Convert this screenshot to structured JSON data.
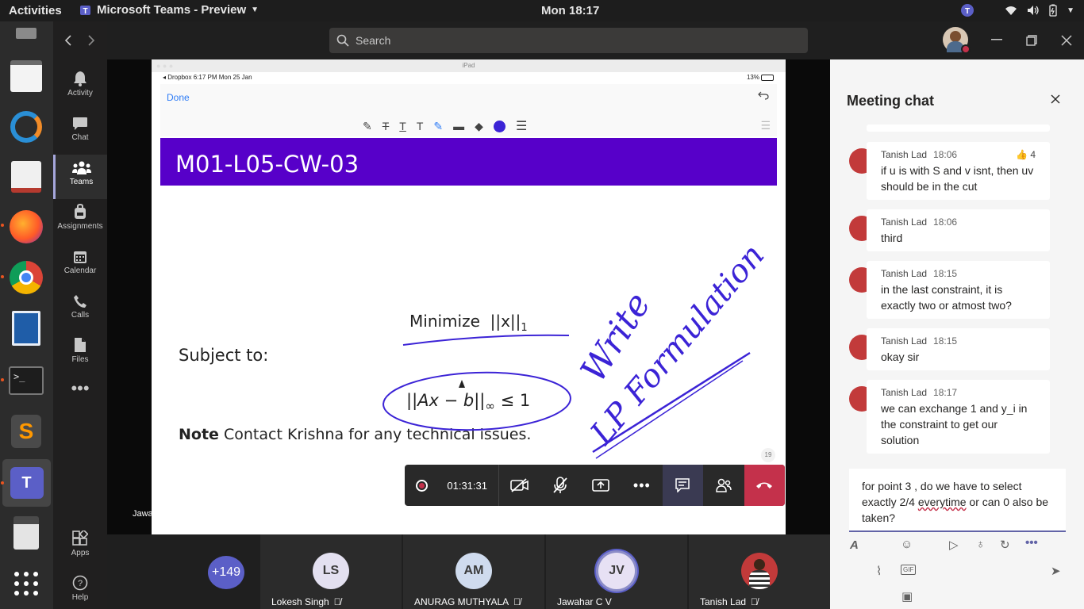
{
  "topbar": {
    "activities": "Activities",
    "app_name": "Microsoft Teams - Preview",
    "clock": "Mon 18:17"
  },
  "rail": [
    {
      "label": "Activity"
    },
    {
      "label": "Chat"
    },
    {
      "label": "Teams"
    },
    {
      "label": "Assignments"
    },
    {
      "label": "Calendar"
    },
    {
      "label": "Calls"
    },
    {
      "label": "Files"
    },
    {
      "label": "Apps"
    },
    {
      "label": "Help"
    }
  ],
  "header": {
    "search_placeholder": "Search"
  },
  "share": {
    "device": "iPad",
    "status_left": "◂ Dropbox  6:17 PM  Mon 25 Jan",
    "battery": "13%",
    "done": "Done",
    "slide_title": "M01-L05-CW-03",
    "minimize": "Minimize",
    "norm_x": "||x||",
    "norm_sub": "1",
    "subject_to": "Subject to:",
    "constraint": "||Ax − b||",
    "constraint_sub": "∞",
    "constraint_rhs": "≤ 1",
    "note_bold": "Note",
    "note_text": "Contact Krishna for any technical issues.",
    "page_no": "19",
    "presenter": "Jawahar C V",
    "handwriting_1": "Write",
    "handwriting_2": "LP Formulation"
  },
  "controls": {
    "timer": "01:31:31"
  },
  "participants": {
    "overflow": "+149",
    "tiles": [
      {
        "initials": "LS",
        "name": "Lokesh Singh",
        "color": "#e3e0f0"
      },
      {
        "initials": "AM",
        "name": "ANURAG MUTHYALA",
        "color": "#cfdbee"
      },
      {
        "initials": "JV",
        "name": "Jawahar C V",
        "color": "#e7e1f4"
      },
      {
        "initials": "",
        "name": "Tanish Lad",
        "color": "#c23a3a"
      }
    ]
  },
  "chat": {
    "title": "Meeting chat",
    "messages": [
      {
        "author": "Tanish Lad",
        "time": "18:06",
        "reaction": "👍 4",
        "text": "if u is with S and v isnt, then uv should be in the cut"
      },
      {
        "author": "Tanish Lad",
        "time": "18:06",
        "text": "third"
      },
      {
        "author": "Tanish Lad",
        "time": "18:15",
        "text": "in the last constraint, it is exactly two or atmost two?"
      },
      {
        "author": "Tanish Lad",
        "time": "18:15",
        "text": "okay sir"
      },
      {
        "author": "Tanish Lad",
        "time": "18:17",
        "text": "we can exchange 1 and y_i in the constraint to get our solution"
      }
    ],
    "compose_a": "for point 3 , do we have to select exactly 2/4 ",
    "compose_err": "everytime",
    "compose_b": " or can 0 also be taken?"
  },
  "colors": {
    "accent": "#6264a7",
    "slide_header": "#5700c9",
    "hangup": "#c4314b",
    "ink": "#3b23d6"
  }
}
